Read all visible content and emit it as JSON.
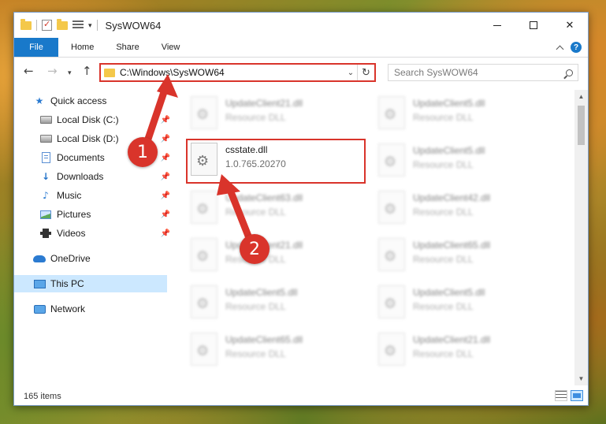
{
  "window": {
    "title": "SysWOW64",
    "minimize_glyph": "",
    "close_glyph": "✕"
  },
  "ribbon": {
    "tabs": [
      {
        "label": "File",
        "active": true
      },
      {
        "label": "Home"
      },
      {
        "label": "Share"
      },
      {
        "label": "View"
      }
    ],
    "help_glyph": "?"
  },
  "address": {
    "path": "C:\\Windows\\SysWOW64",
    "back_glyph": "←",
    "forward_glyph": "→",
    "recent_glyph": "▾",
    "up_glyph": "↑",
    "dropdown_glyph": "⌄",
    "refresh_glyph": "↻"
  },
  "search": {
    "placeholder": "Search SysWOW64"
  },
  "nav": {
    "items": [
      {
        "label": "Quick access",
        "icon": "star-icon"
      },
      {
        "label": "Local Disk (C:)",
        "icon": "disk-icon",
        "pinned": true
      },
      {
        "label": "Local Disk (D:)",
        "icon": "disk-icon",
        "pinned": true
      },
      {
        "label": "Documents",
        "icon": "documents-icon",
        "pinned": true
      },
      {
        "label": "Downloads",
        "icon": "downloads-icon",
        "pinned": true
      },
      {
        "label": "Music",
        "icon": "music-icon",
        "pinned": true
      },
      {
        "label": "Pictures",
        "icon": "pictures-icon",
        "pinned": true
      },
      {
        "label": "Videos",
        "icon": "videos-icon",
        "pinned": true
      },
      {
        "label": "OneDrive",
        "icon": "cloud-icon"
      },
      {
        "label": "This PC",
        "icon": "computer-icon",
        "selected": true
      },
      {
        "label": "Network",
        "icon": "network-icon"
      }
    ],
    "pin_glyph": "📌"
  },
  "files": {
    "left": [
      {
        "name": "UpdateClient21.dll",
        "desc": "Resource DLL"
      },
      {
        "name": "csstate.dll",
        "desc": "1.0.765.20270"
      },
      {
        "name": "UpdateClient63.dll",
        "desc": "Resource DLL"
      },
      {
        "name": "UpdateClient21.dll",
        "desc": "Resource DLL"
      },
      {
        "name": "UpdateClient5.dll",
        "desc": "Resource DLL"
      },
      {
        "name": "UpdateClient65.dll",
        "desc": "Resource DLL"
      }
    ],
    "right": [
      {
        "name": "UpdateClient5.dll",
        "desc": "Resource DLL"
      },
      {
        "name": "UpdateClient5.dll",
        "desc": "Resource DLL"
      },
      {
        "name": "UpdateClient42.dll",
        "desc": "Resource DLL"
      },
      {
        "name": "UpdateClient65.dll",
        "desc": "Resource DLL"
      },
      {
        "name": "UpdateClient5.dll",
        "desc": "Resource DLL"
      },
      {
        "name": "UpdateClient21.dll",
        "desc": "Resource DLL"
      }
    ]
  },
  "status": {
    "item_count": "165 items"
  },
  "annotations": {
    "step1": "1",
    "step2": "2",
    "color": "#d9342b"
  }
}
